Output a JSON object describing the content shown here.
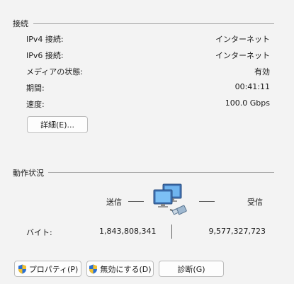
{
  "connection": {
    "title": "接続",
    "rows": [
      {
        "label": "IPv4 接続:",
        "value": "インターネット"
      },
      {
        "label": "IPv6 接続:",
        "value": "インターネット"
      },
      {
        "label": "メディアの状態:",
        "value": "有効"
      },
      {
        "label": "期間:",
        "value": "00:41:11"
      },
      {
        "label": "速度:",
        "value": "100.0 Gbps"
      }
    ],
    "details_button": "詳細(E)..."
  },
  "activity": {
    "title": "動作状況",
    "sent_label": "送信",
    "received_label": "受信",
    "bytes_label": "バイト:",
    "bytes_sent": "1,843,808,341",
    "bytes_received": "9,577,327,723"
  },
  "buttons": {
    "properties": "プロパティ(P)",
    "disable": "無効にする(D)",
    "diagnose": "診断(G)"
  },
  "icons": {
    "network": "network-computers-icon",
    "shield": "uac-shield-icon"
  },
  "colors": {
    "background": "#f3f3f3",
    "shield_blue": "#2a6fd1",
    "shield_yellow": "#f2c12e"
  }
}
